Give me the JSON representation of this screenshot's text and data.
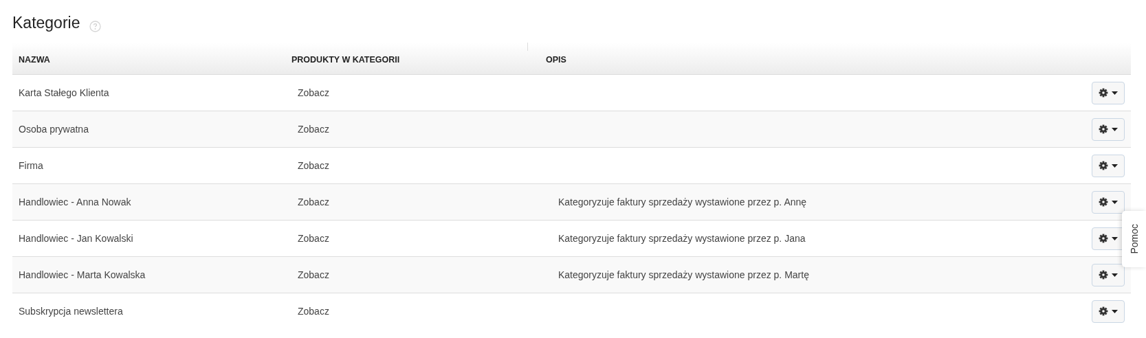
{
  "title": "Kategorie",
  "table": {
    "columns": [
      "NAZWA",
      "PRODUKTY W KATEGORII",
      "OPIS"
    ],
    "rows": [
      {
        "name": "Karta Stałego Klienta",
        "products": "Zobacz"
      },
      {
        "name": "Osoba prywatna",
        "products": "Zobacz"
      },
      {
        "name": "Firma",
        "products": "Zobacz"
      },
      {
        "name": "Handlowiec - Anna Nowak",
        "products": "Zobacz",
        "description": "Kategoryzuje faktury sprzedaży wystawione przez p. Annę"
      },
      {
        "name": "Handlowiec - Jan Kowalski",
        "products": "Zobacz",
        "description": "Kategoryzuje faktury sprzedaży wystawione przez p. Jana"
      },
      {
        "name": "Handlowiec - Marta Kowalska",
        "products": "Zobacz",
        "description": "Kategoryzuje faktury sprzedaży wystawione przez p. Martę"
      },
      {
        "name": "Subskrypcja newslettera",
        "products": "Zobacz"
      }
    ]
  },
  "help_tab": "Pomoc"
}
